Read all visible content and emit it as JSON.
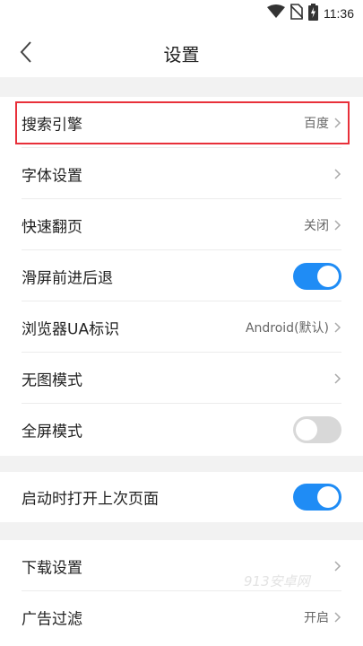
{
  "status_bar": {
    "time": "11:36",
    "icons": [
      "wifi-icon",
      "no-sim-icon",
      "battery-charging-icon"
    ]
  },
  "header": {
    "title": "设置",
    "back_icon": "chevron-left-icon"
  },
  "settings": {
    "search_engine": {
      "label": "搜索引擎",
      "value": "百度"
    },
    "font": {
      "label": "字体设置"
    },
    "quick_page": {
      "label": "快速翻页",
      "value": "关闭"
    },
    "swipe_nav": {
      "label": "滑屏前进后退",
      "enabled": true
    },
    "browser_ua": {
      "label": "浏览器UA标识",
      "value": "Android(默认)"
    },
    "no_image": {
      "label": "无图模式"
    },
    "fullscreen": {
      "label": "全屏模式",
      "enabled": false
    },
    "restore_last": {
      "label": "启动时打开上次页面",
      "enabled": true
    },
    "download": {
      "label": "下载设置"
    },
    "ad_filter": {
      "label": "广告过滤",
      "value": "开启"
    }
  },
  "watermark": "913安卓网",
  "colors": {
    "accent": "#1f8cf5",
    "highlight": "#e8303a",
    "background": "#f2f2f2"
  }
}
